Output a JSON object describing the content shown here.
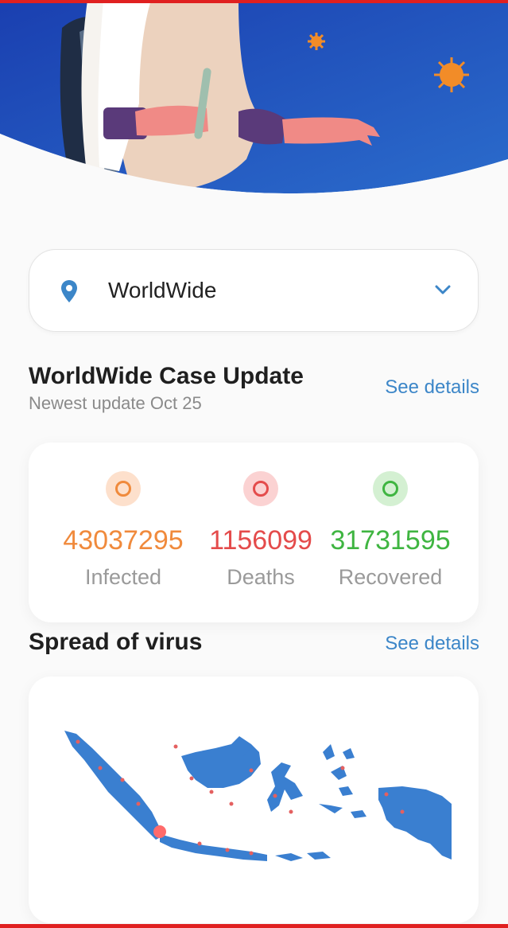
{
  "location": {
    "selected": "WorldWide"
  },
  "case_update": {
    "title": "WorldWide Case Update",
    "subtitle": "Newest update Oct 25",
    "see_details": "See details"
  },
  "stats": [
    {
      "value": "43037295",
      "label": "Infected",
      "color": "#f08a3c",
      "ring": "#fde0cc"
    },
    {
      "value": "1156099",
      "label": "Deaths",
      "color": "#e44b4b",
      "ring": "#fbd2d2"
    },
    {
      "value": "31731595",
      "label": "Recovered",
      "color": "#3fb541",
      "ring": "#d4f0d2"
    }
  ],
  "spread": {
    "title": "Spread of virus",
    "see_details": "See details"
  },
  "colors": {
    "hero_blue": "#1e48b5",
    "accent_blue": "#3c86c8",
    "map_blue": "#3a7fd0",
    "hotspot_red": "#ff6b6b"
  }
}
